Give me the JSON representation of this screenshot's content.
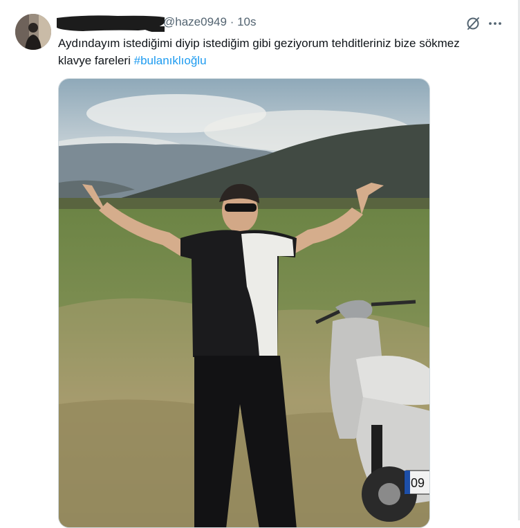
{
  "tweet": {
    "handle": "@haze0949",
    "separator": "·",
    "time": "10s",
    "text_main": "Aydındayım istediğimi diyip istediğim gibi geziyorum tehditleriniz bize sökmez klavye fareleri ",
    "hashtag": "#bulanıklıoğlu"
  },
  "media": {
    "plate_text": "09"
  },
  "icons": {
    "grok": "grok-icon",
    "more": "more-icon"
  },
  "colors": {
    "text": "#0f1419",
    "secondary": "#536471",
    "link": "#1d9bf0",
    "border": "#cfd9de"
  }
}
